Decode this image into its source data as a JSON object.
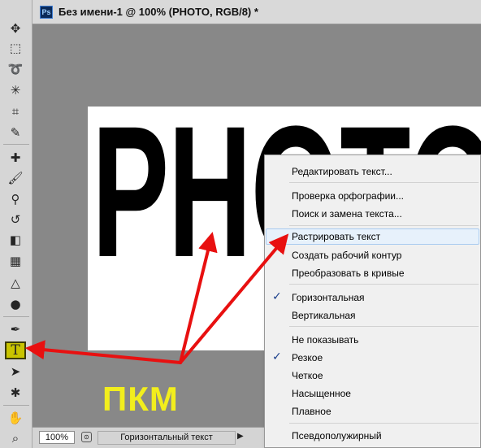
{
  "window": {
    "title": "Без имени-1 @ 100% (PHOTO, RGB/8) *",
    "app_icon_text": "Ps"
  },
  "tools": [
    {
      "name": "move-tool-icon",
      "glyph": "✥"
    },
    {
      "name": "marquee-tool-icon",
      "glyph": "⬚"
    },
    {
      "name": "lasso-tool-icon",
      "glyph": "➰"
    },
    {
      "name": "magic-wand-tool-icon",
      "glyph": "✳"
    },
    {
      "name": "crop-tool-icon",
      "glyph": "⌗"
    },
    {
      "name": "eyedropper-tool-icon",
      "glyph": "✎"
    },
    {
      "name": "healing-brush-tool-icon",
      "glyph": "✚"
    },
    {
      "name": "brush-tool-icon",
      "glyph": "🖌"
    },
    {
      "name": "clone-stamp-tool-icon",
      "glyph": "⚲"
    },
    {
      "name": "history-brush-tool-icon",
      "glyph": "↺"
    },
    {
      "name": "eraser-tool-icon",
      "glyph": "◧"
    },
    {
      "name": "gradient-tool-icon",
      "glyph": "▦"
    },
    {
      "name": "blur-tool-icon",
      "glyph": "△"
    },
    {
      "name": "dodge-tool-icon",
      "glyph": "●"
    },
    {
      "name": "pen-tool-icon",
      "glyph": "✒"
    },
    {
      "name": "type-tool-icon",
      "glyph": "T"
    },
    {
      "name": "path-selection-tool-icon",
      "glyph": "➤"
    },
    {
      "name": "custom-shape-tool-icon",
      "glyph": "✱"
    },
    {
      "name": "hand-tool-icon",
      "glyph": "✋"
    },
    {
      "name": "zoom-tool-icon",
      "glyph": "⌕"
    }
  ],
  "canvas": {
    "text": "PHOTO"
  },
  "status_bar": {
    "zoom": "100%",
    "info": "Горизонтальный текст",
    "arrow": "▶"
  },
  "context_menu": {
    "items": [
      {
        "label": "Редактировать текст...",
        "checked": false,
        "highlighted": false
      },
      {
        "label": "Проверка орфографии...",
        "checked": false,
        "highlighted": false
      },
      {
        "label": "Поиск и замена текста...",
        "checked": false,
        "highlighted": false
      },
      {
        "label": "Растрировать текст",
        "checked": false,
        "highlighted": true
      },
      {
        "label": "Создать рабочий контур",
        "checked": false,
        "highlighted": false
      },
      {
        "label": "Преобразовать в кривые",
        "checked": false,
        "highlighted": false
      },
      {
        "label": "Горизонтальная",
        "checked": true,
        "highlighted": false
      },
      {
        "label": "Вертикальная",
        "checked": false,
        "highlighted": false
      },
      {
        "label": "Не показывать",
        "checked": false,
        "highlighted": false
      },
      {
        "label": "Резкое",
        "checked": true,
        "highlighted": false
      },
      {
        "label": "Четкое",
        "checked": false,
        "highlighted": false
      },
      {
        "label": "Насыщенное",
        "checked": false,
        "highlighted": false
      },
      {
        "label": "Плавное",
        "checked": false,
        "highlighted": false
      },
      {
        "label": "Псевдополужирный",
        "checked": false,
        "highlighted": false
      }
    ],
    "checkmark": "✓"
  },
  "annotation": {
    "label": "ПКМ",
    "arrow_color": "#e81010",
    "label_color": "#f2ee1d"
  },
  "colors": {
    "active_tool": "#c9c400",
    "menu_highlight": "#e7f1fb",
    "canvas_bg": "#888888"
  }
}
